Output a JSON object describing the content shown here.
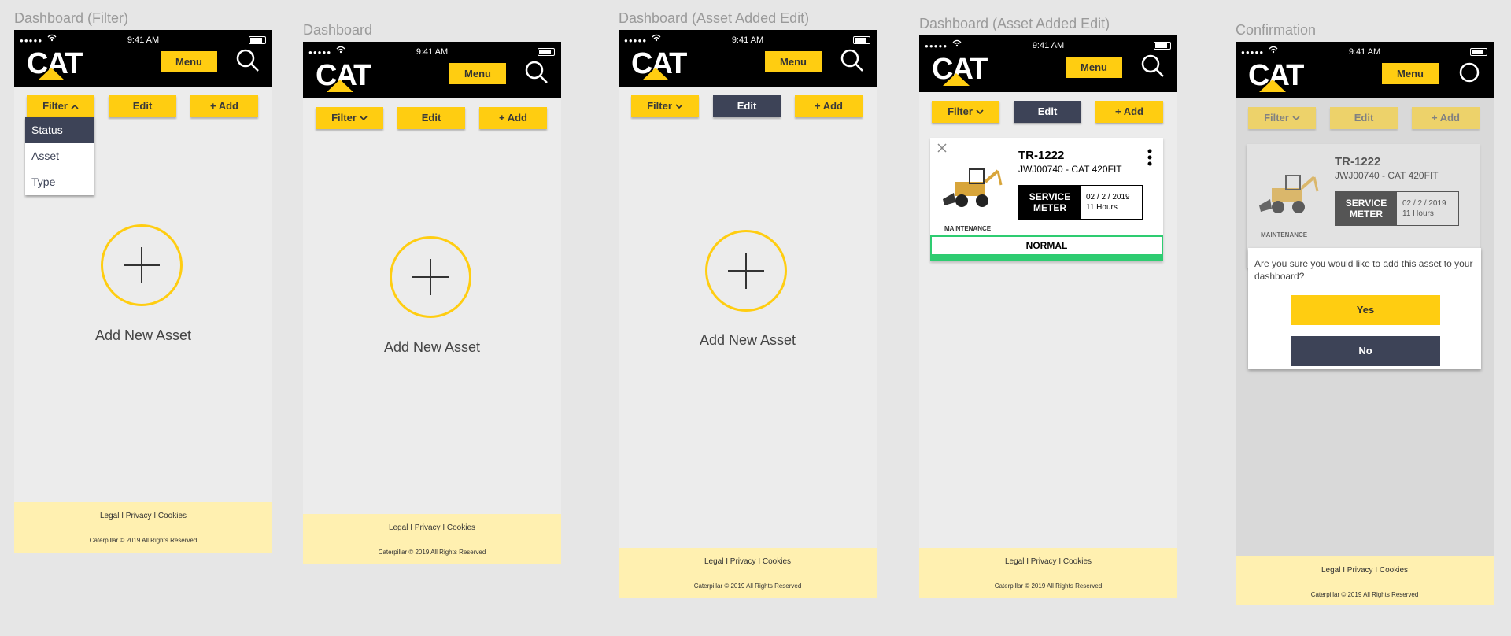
{
  "colors": {
    "accent": "#ffcd11",
    "dark": "#3d4357",
    "footer": "#fff0b0",
    "status_ok": "#2ecc71"
  },
  "common": {
    "time": "9:41 AM",
    "logo": "CAT",
    "menu": "Menu",
    "filter": "Filter",
    "edit": "Edit",
    "add": "+ Add",
    "add_new_asset": "Add New Asset",
    "footer_links": "Legal I Privacy I Cookies",
    "footer_copy": "Caterpillar © 2019 All Rights Reserved",
    "signal": "●●●●●"
  },
  "artboards": [
    {
      "title": "Dashboard (Filter)"
    },
    {
      "title": "Dashboard"
    },
    {
      "title": "Dashboard (Asset Added Edit)"
    },
    {
      "title": "Dashboard (Asset Added Edit)"
    },
    {
      "title": "Confirmation"
    }
  ],
  "filter_dropdown": {
    "options": [
      "Status",
      "Asset",
      "Type"
    ],
    "selected": "Status"
  },
  "asset": {
    "id": "TR-1222",
    "model": "JWJ00740 - CAT 420FIT",
    "meter_label_1": "SERVICE",
    "meter_label_2": "METER",
    "meter_date": "02 / 2 / 2019",
    "meter_hours": "11 Hours",
    "category": "MAINTENANCE",
    "status": "NORMAL"
  },
  "confirm": {
    "question": "Are you sure you would like to add this asset to your dashboard?",
    "yes": "Yes",
    "no": "No"
  }
}
